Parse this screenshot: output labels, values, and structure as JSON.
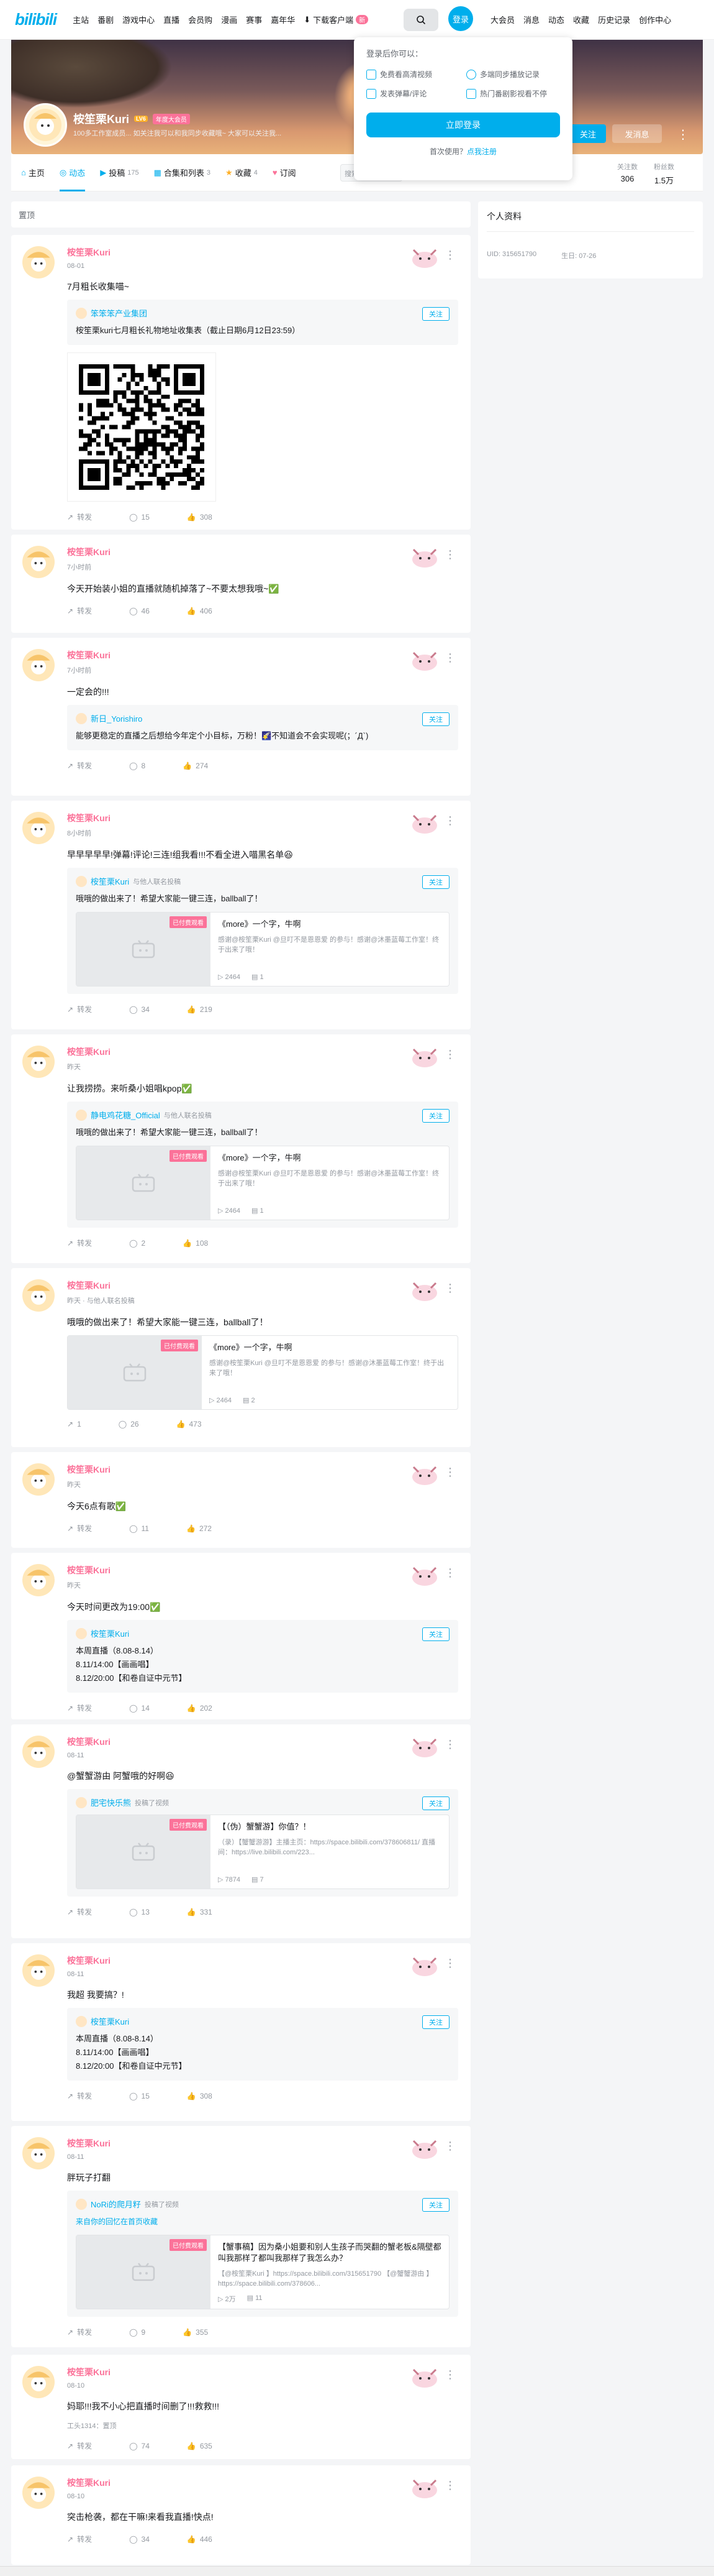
{
  "nav": {
    "logo": "bilibili",
    "items": [
      "主站",
      "番剧",
      "游戏中心",
      "直播",
      "会员购",
      "漫画",
      "赛事",
      "嘉年华"
    ],
    "download": "下载客户端",
    "download_badge": "新",
    "login": "登录",
    "right": [
      "大会员",
      "消息",
      "动态",
      "收藏",
      "历史记录",
      "创作中心"
    ]
  },
  "profile": {
    "name": "桉笙栗Kuri",
    "level": "LV6",
    "vip": "年度大会员",
    "sign": "100多工作室成员... 如关注我可以和我同步收藏哦~ 大家可以关注我...",
    "follow": "关注",
    "message": "发消息"
  },
  "tabs": [
    {
      "label": "主页",
      "count": ""
    },
    {
      "label": "动态",
      "count": ""
    },
    {
      "label": "投稿",
      "count": "175"
    },
    {
      "label": "合集和列表",
      "count": "3"
    },
    {
      "label": "收藏",
      "count": "4"
    },
    {
      "label": "订阅",
      "count": ""
    }
  ],
  "tab_search_placeholder": "搜索视频、动态",
  "stats": {
    "following_label": "关注数",
    "following": "306",
    "followers_label": "粉丝数",
    "followers": "1.5万"
  },
  "feed_header": "置顶",
  "side": {
    "title": "个人资料",
    "uid": "UID: 315651790",
    "birthday": "生日: 07-26"
  },
  "popup": {
    "title": "登录后你可以：",
    "features": [
      "免费看高清视频",
      "多端同步播放记录",
      "发表弹幕/评论",
      "热门番剧影视看不停"
    ],
    "login_btn": "立即登录",
    "register_prefix": "首次使用？",
    "register_link": "点我注册"
  },
  "cards": [
    {
      "time": "08-01",
      "text": "7月粗长收集喵~",
      "sub": {
        "name": "笨笨笨产业集团",
        "time": "",
        "text": "桉笙栗kuri七月粗长礼物地址收集表（截止日期6月12日23:59）",
        "follow": "关注"
      },
      "qr": true,
      "actions": {
        "share": "转发",
        "comment": "15",
        "like": "308"
      }
    },
    {
      "time": "7小时前",
      "text": "今天开始装小姐的直播就随机掉落了~不要太想我哦~✅",
      "actions": {
        "share": "转发",
        "comment": "46",
        "like": "406"
      }
    },
    {
      "time": "7小时前",
      "text": "一定会的!!!",
      "sub": {
        "name": "新日_Yorishiro",
        "time": "",
        "text": "能够更稳定的直播之后想给今年定个小目标，万粉！🌠不知道会不会实现呢(；´Д`)",
        "follow": "关注"
      },
      "actions": {
        "share": "转发",
        "comment": "8",
        "like": "274"
      }
    },
    {
      "time": "8小时前",
      "text": "早早早早早!弹幕!评论!三连!组我看!!!不看全进入喵黑名单😆",
      "sub": {
        "name": "桉笙栗Kuri",
        "time": "与他人联名投稿",
        "text": "哦哦的做出来了！希望大家能一键三连，ballball了！",
        "follow": "关注",
        "video": {
          "tag": "已付费观看",
          "title": "《more》一个字，牛啊",
          "desc": "感谢@桉笙栗Kuri @旦叮不是恩恩爱 的参与！感谢@沐墨蓝莓工作室！终于出来了哦！",
          "views": "2464",
          "danmaku": "1"
        }
      },
      "actions": {
        "share": "转发",
        "comment": "34",
        "like": "219"
      }
    },
    {
      "time": "昨天",
      "text": "让我捞捞。来听桑小姐唱kpop✅",
      "sub": {
        "name": "静电鸡花糖_Official",
        "time": "与他人联名投稿",
        "text": "哦哦的做出来了！希望大家能一键三连，ballball了！",
        "follow": "关注",
        "video": {
          "tag": "已付费观看",
          "title": "《more》一个字，牛啊",
          "desc": "感谢@桉笙栗Kuri @旦叮不是恩恩爱 的参与！感谢@沐墨蓝莓工作室！终于出来了哦！",
          "views": "2464",
          "danmaku": "1"
        }
      },
      "actions": {
        "share": "转发",
        "comment": "2",
        "like": "108"
      }
    },
    {
      "time": "昨天 · 与他人联名投稿",
      "text": "哦哦的做出来了！希望大家能一键三连，ballball了！",
      "video": {
        "tag": "已付费观看",
        "title": "《more》一个字，牛啊",
        "desc": "感谢@桉笙栗Kuri @旦叮不是恩恩爱 的参与！感谢@沐墨蓝莓工作室！终于出来了哦！",
        "views": "2464",
        "danmaku": "2"
      },
      "actions": {
        "share": "1",
        "comment": "26",
        "like": "473"
      }
    },
    {
      "time": "昨天",
      "text": "今天6点有歌✅",
      "actions": {
        "share": "转发",
        "comment": "11",
        "like": "272"
      }
    },
    {
      "time": "昨天",
      "text": "今天时间更改为19:00✅",
      "sub": {
        "name": "桉笙栗Kuri",
        "time": "",
        "text": "本周直播（8.08-8.14）\n8.11/14:00【画画唱】\n8.12/20:00【和卷自证中元节】",
        "follow": "关注"
      },
      "actions": {
        "share": "转发",
        "comment": "14",
        "like": "202"
      }
    },
    {
      "time": "08-11",
      "text": "@蟹蟹游由 阿蟹哦的好啊😆",
      "sub": {
        "name": "肥宅快乐熊",
        "time": "投稿了视频",
        "text": "",
        "follow": "关注",
        "video": {
          "tag": "已付费观看",
          "title": "【（伪）蟹蟹游】你值？！",
          "desc": "（录）【蟹蟹游游】主播主页：https://space.bilibili.com/378606811/ 直播间：https://live.bilibili.com/223...",
          "views": "7874",
          "danmaku": "7"
        }
      },
      "actions": {
        "share": "转发",
        "comment": "13",
        "like": "331"
      }
    },
    {
      "time": "08-11",
      "text": "我超 我要搞？!",
      "sub": {
        "name": "桉笙栗Kuri",
        "time": "",
        "text": "本周直播（8.08-8.14）\n8.11/14:00【画画唱】\n8.12/20:00【和卷自证中元节】",
        "follow": "关注"
      },
      "actions": {
        "share": "转发",
        "comment": "15",
        "like": "308"
      }
    },
    {
      "time": "08-11",
      "text": "胖玩子打翻",
      "sub": {
        "name": "NoRi的爬月籽",
        "time": "投稿了视频",
        "text": "",
        "follow": "关注",
        "note": "来自你的回忆在首页收藏",
        "video": {
          "tag": "已付费观看",
          "title": "【蟹事稿】因为桑小姐要和别人生孩子而哭翻的蟹老板&隔壁都叫我那样了都叫我那样了我怎么办？",
          "desc": "【@桉笙栗Kuri 】https://space.bilibili.com/315651790 【@蟹蟹游由 】https://space.bilibili.com/378606...",
          "views": "2万",
          "danmaku": "11"
        }
      },
      "actions": {
        "share": "转发",
        "comment": "9",
        "like": "355"
      }
    },
    {
      "time": "08-10",
      "text": "妈耶!!!我不小心把直播时间删了!!!救救!!!",
      "note": "工头1314：置顶",
      "actions": {
        "share": "转发",
        "comment": "74",
        "like": "635"
      }
    },
    {
      "time": "08-10",
      "text": "突击枪袭，都在干嘛!来看我直播!快点!",
      "actions": {
        "share": "转发",
        "comment": "34",
        "like": "446"
      }
    }
  ]
}
